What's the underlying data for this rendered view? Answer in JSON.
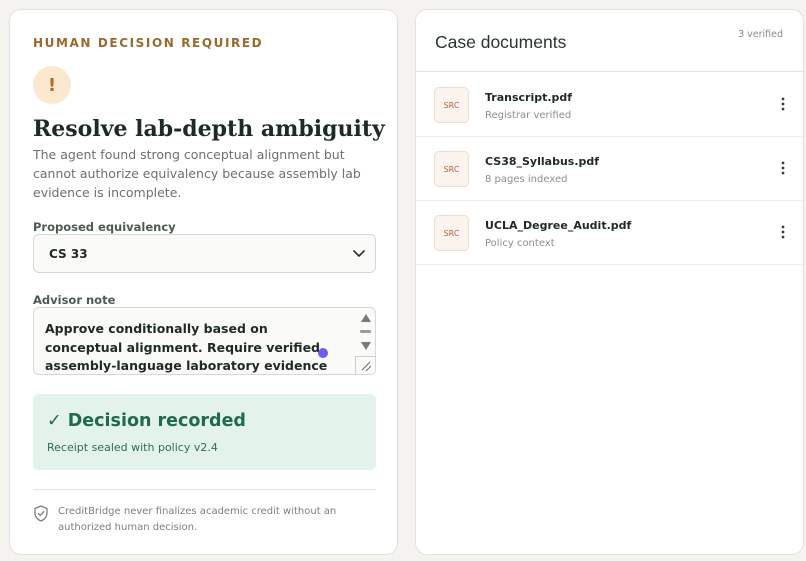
{
  "decision_panel": {
    "eyebrow": "HUMAN DECISION REQUIRED",
    "alert_glyph": "!",
    "title": "Resolve lab-depth ambiguity",
    "description": "The agent found strong conceptual alignment but cannot authorize equivalency because assembly lab evidence is incomplete.",
    "equivalency_label": "Proposed equivalency",
    "equivalency_value": "CS 33",
    "note_label": "Advisor note",
    "note_text": "Approve conditionally based on conceptual alignment. Require verified assembly-language laboratory evidence before final articulation.",
    "decision_title": "✓ Decision recorded",
    "decision_subtitle": "Receipt sealed with policy v2.4",
    "footnote": "CreditBridge never finalizes academic credit without an authorized human decision."
  },
  "documents_panel": {
    "title": "Case documents",
    "verified_count": "3 verified",
    "documents": [
      {
        "badge": "SRC",
        "name": "Transcript.pdf",
        "meta": "Registrar verified"
      },
      {
        "badge": "SRC",
        "name": "CS38_Syllabus.pdf",
        "meta": "8 pages indexed"
      },
      {
        "badge": "SRC",
        "name": "UCLA_Degree_Audit.pdf",
        "meta": "Policy context"
      }
    ]
  },
  "icons": {
    "alert": "alert-icon",
    "chevron": "chevron-down-icon",
    "shield": "shield-check-icon",
    "menu": "more-vertical-icon"
  },
  "colors": {
    "accent_amber": "#9a6a2c",
    "success_green": "#1f6b4d",
    "success_bg": "#e3f2ea",
    "badge_text": "#b4623b"
  }
}
